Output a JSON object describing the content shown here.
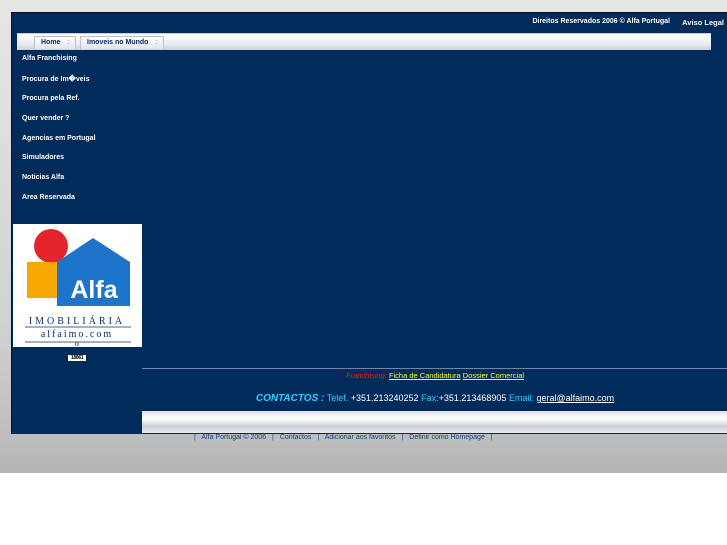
{
  "header": {
    "copyright": "Direitos Reservados 2006 © Alfa Portugal",
    "aviso_legal": "Aviso Legal"
  },
  "nav": {
    "tabs": [
      {
        "label": "Home"
      },
      {
        "label": "Imoveis no Mundo"
      }
    ]
  },
  "sidebar": {
    "items": [
      {
        "label": "Alfa Franchising"
      },
      {
        "label": "Procura de Im�veis"
      },
      {
        "label": "Procura pela Ref."
      },
      {
        "label": "Quer vender ?"
      },
      {
        "label": "Agencias em Portugal"
      },
      {
        "label": "Simuladores"
      },
      {
        "label": "Noticias Alfa"
      },
      {
        "label": "Area Reservada"
      }
    ],
    "counter": "18061"
  },
  "logo": {
    "name": "Alfa",
    "subtitle": "IMOBILIÁRIA",
    "site": "alfaimo.com",
    "symbol": "α"
  },
  "franchising": {
    "label": "Franchising:",
    "link1": "Ficha de Candidatura",
    "link2": "Dossier Comercial"
  },
  "contacts": {
    "title": "CONTACTOS :",
    "tel_label": "Telef.",
    "tel": "+351.213240252",
    "fax_label": "Fax:",
    "fax": "+351.213468905",
    "email_label": "Email:",
    "email": "geral@alfaimo.com"
  },
  "footer": {
    "links": [
      {
        "label": "Alfa Portugal © 2006"
      },
      {
        "label": "Contactos"
      },
      {
        "label": "Adicionar aos favoritos"
      },
      {
        "label": "Definir como Homepage"
      }
    ],
    "separator": "|"
  },
  "colors": {
    "frame": "#002b5b",
    "accent_cyan": "#33ccff",
    "link_yellow": "#ffff33",
    "franchising_red": "#ff1a1a",
    "logo_red": "#e4262b",
    "logo_yellow": "#f5a800",
    "logo_blue": "#1e74c8"
  }
}
